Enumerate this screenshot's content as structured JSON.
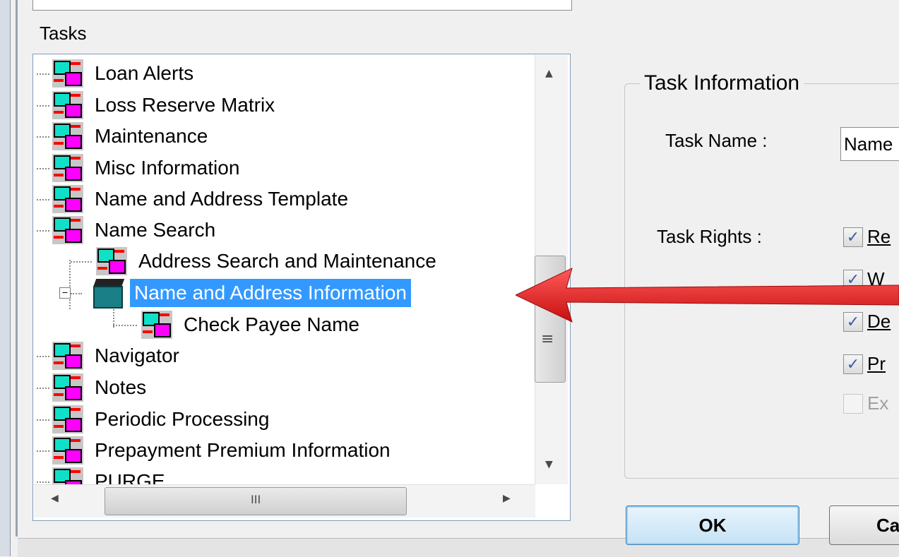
{
  "tasks_label": "Tasks",
  "tree": {
    "items": [
      {
        "label": "Loan Alerts"
      },
      {
        "label": "Loss Reserve Matrix"
      },
      {
        "label": "Maintenance"
      },
      {
        "label": "Misc Information"
      },
      {
        "label": "Name and Address Template"
      },
      {
        "label": "Name Search"
      },
      {
        "label": "Address Search and Maintenance"
      },
      {
        "label": "Name and Address Information"
      },
      {
        "label": "Check Payee Name"
      },
      {
        "label": "Navigator"
      },
      {
        "label": "Notes"
      },
      {
        "label": "Periodic Processing"
      },
      {
        "label": "Prepayment Premium Information"
      },
      {
        "label": "PURGE"
      }
    ],
    "selected": "Name and Address Information",
    "expander_symbol": "−"
  },
  "scrollbar": {
    "up_arrow": "▲",
    "down_arrow": "▼",
    "left_arrow": "◀",
    "right_arrow": "▶",
    "thumb_grip_v": "≡",
    "thumb_grip_h": "III"
  },
  "task_info": {
    "title": "Task Information",
    "task_name_label": "Task Name :",
    "task_name_value": "Name",
    "task_rights_label": "Task Rights :",
    "rights": [
      {
        "label": "Re",
        "checked": true
      },
      {
        "label": "W",
        "checked": true
      },
      {
        "label": "De",
        "checked": true
      },
      {
        "label": "Pr",
        "checked": true
      },
      {
        "label": "Ex",
        "checked": false
      }
    ],
    "checkmark": "✓"
  },
  "buttons": {
    "ok": "OK",
    "cancel": "Ca"
  },
  "annotation": {
    "arrow_color": "#e51c1c"
  }
}
